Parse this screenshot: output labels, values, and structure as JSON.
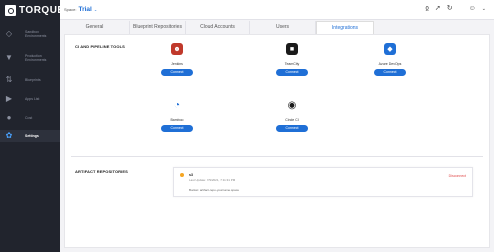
{
  "app": {
    "logo_text": "TORQUE"
  },
  "sidebar": {
    "items": [
      {
        "label": "Sandbox Environments",
        "icon": "diamond-icon",
        "active": false
      },
      {
        "label": "Production Environments",
        "icon": "filter-icon",
        "active": false
      },
      {
        "label": "Blueprints",
        "icon": "blueprint-icon",
        "active": false
      },
      {
        "label": "Apps List",
        "icon": "apps-icon",
        "active": false
      },
      {
        "label": "Cost",
        "icon": "cost-icon",
        "active": false
      },
      {
        "label": "Settings",
        "icon": "gear-icon",
        "active": true
      }
    ]
  },
  "topbar": {
    "space_label": "Space:",
    "space_name": "Trial",
    "icons": [
      "ear-icon",
      "rocket-icon",
      "refresh-icon",
      "user-icon",
      "chevron-down-icon"
    ]
  },
  "tabs": [
    {
      "label": "General",
      "active": false
    },
    {
      "label": "Blueprint Repositories",
      "active": false
    },
    {
      "label": "Cloud Accounts",
      "active": false
    },
    {
      "label": "Users",
      "active": false
    },
    {
      "label": "Integrations",
      "active": true
    }
  ],
  "ci_section": {
    "title": "CI AND PIPELINE TOOLS",
    "tools": [
      {
        "name": "Jenkins",
        "button": "Connect",
        "icon": "jenkins-icon",
        "color": "#c0392b"
      },
      {
        "name": "TeamCity",
        "button": "Connect",
        "icon": "teamcity-icon",
        "color": "#1a1a1a"
      },
      {
        "name": "Azure DevOps",
        "button": "Connect",
        "icon": "azure-devops-icon",
        "color": "#1f6fd6"
      },
      {
        "name": "Bamboo",
        "button": "Connect",
        "icon": "bamboo-icon",
        "color": "#1f6fd6"
      },
      {
        "name": "Circle CI",
        "button": "Connect",
        "icon": "circleci-icon",
        "color": "#1a1a1a"
      }
    ]
  },
  "artifact_section": {
    "title": "ARTIFACT REPOSITORIES",
    "repo": {
      "name": "s3",
      "updated": "Last Update: 7/9/2021, 7:11:31 PM",
      "bucket": "Bucket: artifact-repo-yourname.space",
      "disconnect": "Disconnect"
    }
  },
  "colors": {
    "accent": "#1f6fd6",
    "sidebar_bg": "#21242d",
    "danger": "#e04848"
  }
}
